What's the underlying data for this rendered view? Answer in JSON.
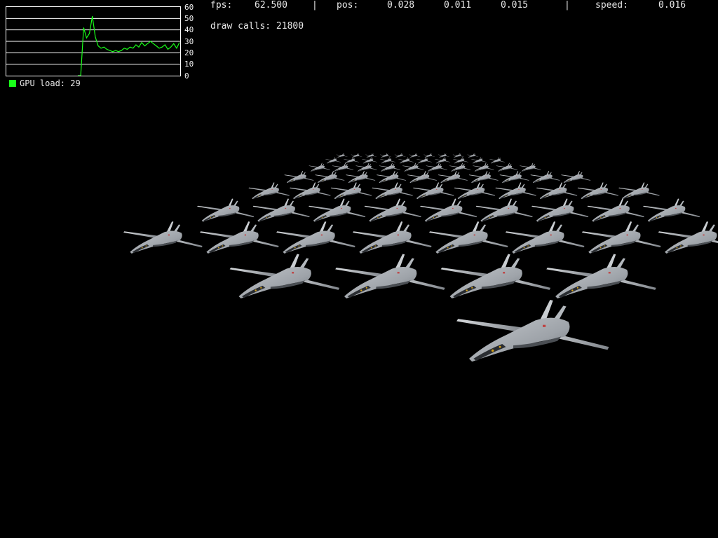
{
  "stats": {
    "fps_label": "fps:",
    "fps_value": "62.500",
    "sep1": "|",
    "pos_label": "pos:",
    "pos_x": "0.028",
    "pos_y": "0.011",
    "pos_z": "0.015",
    "sep2": "|",
    "speed_label": "speed:",
    "speed_value": "0.016",
    "draw_calls": "draw calls: 21800"
  },
  "gpu_graph": {
    "legend": "GPU load: 29",
    "ticks": [
      "60",
      "50",
      "40",
      "30",
      "20",
      "10",
      "0"
    ],
    "ylim": [
      0,
      60
    ],
    "series_color": "#19ff19",
    "values": [
      0,
      0,
      42,
      33,
      37,
      52,
      34,
      26,
      24,
      25,
      23,
      22,
      21,
      22,
      21,
      22,
      24,
      23,
      25,
      24,
      27,
      25,
      29,
      26,
      28,
      30,
      28,
      26,
      24,
      25,
      27,
      23,
      25,
      28,
      24,
      29
    ]
  },
  "scene": {
    "description_colors": {
      "background": "#000000",
      "jet_body": "#a7acb2",
      "jet_shadow": "#5f646a"
    }
  }
}
